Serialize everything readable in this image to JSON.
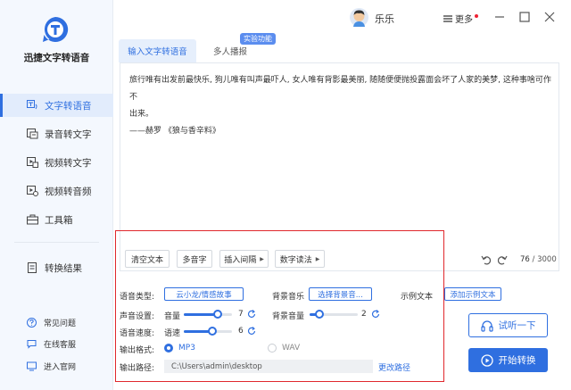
{
  "app": {
    "title": "迅捷文字转语音",
    "accent": "#2f6fe0",
    "logo_icon": "speech-t-logo"
  },
  "sidebar": {
    "items": [
      {
        "label": "文字转语音",
        "icon": "text-speech-icon",
        "active": true
      },
      {
        "label": "录音转文字",
        "icon": "record-text-icon",
        "active": false
      },
      {
        "label": "视频转文字",
        "icon": "video-text-icon",
        "active": false
      },
      {
        "label": "视频转音频",
        "icon": "video-audio-icon",
        "active": false
      },
      {
        "label": "工具箱",
        "icon": "toolbox-icon",
        "active": false
      },
      {
        "label": "转换结果",
        "icon": "result-icon",
        "active": false
      }
    ],
    "footer": [
      {
        "label": "常见问题",
        "icon": "question-icon"
      },
      {
        "label": "在线客服",
        "icon": "chat-icon"
      },
      {
        "label": "进入官网",
        "icon": "website-icon"
      }
    ]
  },
  "topbar": {
    "username": "乐乐",
    "more_label": "更多"
  },
  "tabs": [
    {
      "label": "输入文字转语音",
      "active": true
    },
    {
      "label": "多人播报",
      "active": false
    }
  ],
  "badge": "实验功能",
  "editor": {
    "lines": [
      "旅行唯有出发前最快乐, 狗儿唯有叫声最吓人, 女人唯有背影最美丽, 随随便便抛投露面会坏了人家的美梦, 这种事啥可作不",
      "出来。",
      "——赫罗 《狼与香辛料》"
    ],
    "char_count": "76",
    "char_limit": "/ 3000"
  },
  "toolbar": {
    "clear": "清空文本",
    "polyphone": "多音字",
    "insert_pause": "插入间隔",
    "number_read": "数字读法"
  },
  "settings": {
    "voice_type_label": "语音类型:",
    "voice_type_value": "云小龙/情感故事",
    "bgm_label": "背景音乐",
    "bgm_button": "选择背景音...",
    "sample_label": "示例文本",
    "sample_button": "添加示例文本",
    "sound_label": "声音设置:",
    "volume_label": "音量",
    "volume_value": "7",
    "volume_fraction": 0.7,
    "bg_volume_label": "背景音量",
    "bg_volume_value": "2",
    "bg_volume_fraction": 0.2,
    "speed_label": "语音速度:",
    "speed_sub_label": "语速",
    "speed_value": "6",
    "speed_fraction": 0.6,
    "format_label": "输出格式:",
    "format_options": [
      "MP3",
      "WAV"
    ],
    "format_selected": "MP3",
    "path_label": "输出路径:",
    "path_value": "C:\\Users\\admin\\desktop",
    "change_path": "更改路径"
  },
  "actions": {
    "try": "试听一下",
    "start": "开始转换"
  }
}
